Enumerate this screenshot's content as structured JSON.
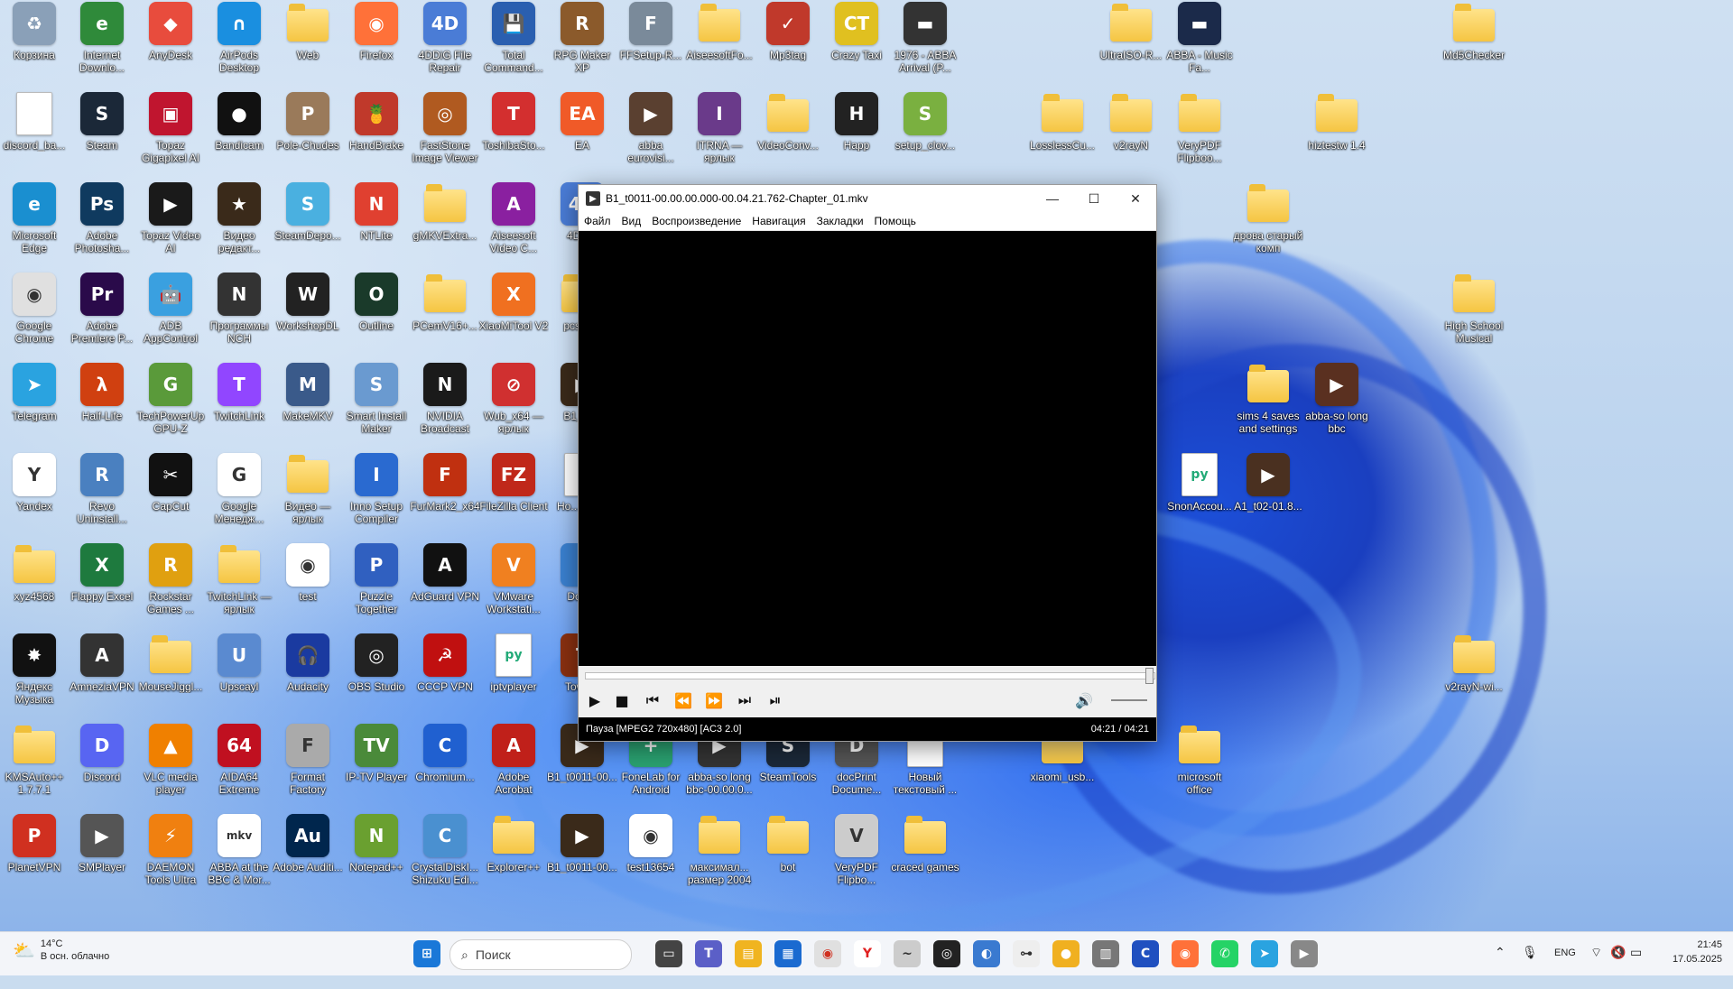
{
  "desktop": {
    "icons": [
      {
        "label": "Корзина",
        "color": "#8aa0b8",
        "glyph": "♻"
      },
      {
        "label": "Internet Downlo...",
        "color": "#2f8a3a",
        "glyph": "e"
      },
      {
        "label": "AnyDesk",
        "color": "#e84c3d",
        "glyph": "◆"
      },
      {
        "label": "AirPods Desktop",
        "color": "#1a8fe0",
        "glyph": "∩"
      },
      {
        "label": "Web",
        "color": "folder",
        "glyph": ""
      },
      {
        "label": "Firefox",
        "color": "#ff7139",
        "glyph": "◉"
      },
      {
        "label": "4DDiG File Repair",
        "color": "#4a7cd6",
        "glyph": "4D"
      },
      {
        "label": "Total Command...",
        "color": "#2a5fb0",
        "glyph": "💾"
      },
      {
        "label": "RPG Maker XP",
        "color": "#8b5a2b",
        "glyph": "R"
      },
      {
        "label": "FFSetup-R...",
        "color": "#7a8a9a",
        "glyph": "F"
      },
      {
        "label": "AiseesoftFo...",
        "color": "folder",
        "glyph": ""
      },
      {
        "label": "Mp3tag",
        "color": "#c0392b",
        "glyph": "✓"
      },
      {
        "label": "Crazy Taxi",
        "color": "#e0c020",
        "glyph": "CT"
      },
      {
        "label": "1976 - ABBA Arrival (P...",
        "color": "#333333",
        "glyph": "▬"
      },
      {
        "label": "UltraISO-R...",
        "color": "folder",
        "glyph": ""
      },
      {
        "label": "ABBA - Music Fa...",
        "color": "#1b2a4a",
        "glyph": "▬"
      },
      {
        "label": "Md5Checker",
        "color": "folder",
        "glyph": ""
      },
      {
        "label": "discord_ba...",
        "color": "doc",
        "glyph": ""
      },
      {
        "label": "Steam",
        "color": "#1b2838",
        "glyph": "S"
      },
      {
        "label": "Topaz Gigapixel AI",
        "color": "#c0152f",
        "glyph": "▣"
      },
      {
        "label": "Bandicam",
        "color": "#111111",
        "glyph": "●"
      },
      {
        "label": "Pole-Chudes",
        "color": "#9a7a5a",
        "glyph": "P"
      },
      {
        "label": "HandBrake",
        "color": "#c0392b",
        "glyph": "🍍"
      },
      {
        "label": "FastStone Image Viewer",
        "color": "#b05a20",
        "glyph": "◎"
      },
      {
        "label": "ToshibaSto...",
        "color": "#d32f2f",
        "glyph": "T"
      },
      {
        "label": "EA",
        "color": "#f05a28",
        "glyph": "EA"
      },
      {
        "label": "abba eurovisi...",
        "color": "#5a4030",
        "glyph": "▶"
      },
      {
        "label": "ITRNA — ярлык",
        "color": "#6a3a8a",
        "glyph": "I"
      },
      {
        "label": "VideoConv...",
        "color": "folder",
        "glyph": ""
      },
      {
        "label": "Happ",
        "color": "#222222",
        "glyph": "H"
      },
      {
        "label": "setup_clov...",
        "color": "#7ab040",
        "glyph": "S"
      },
      {
        "label": "LosslessCu...",
        "color": "folder",
        "glyph": ""
      },
      {
        "label": "v2rayN",
        "color": "folder",
        "glyph": ""
      },
      {
        "label": "VeryPDF Flipboo...",
        "color": "folder",
        "glyph": ""
      },
      {
        "label": "hiztestw 1.4",
        "color": "folder",
        "glyph": ""
      },
      {
        "label": "Microsoft Edge",
        "color": "#1a8fd0",
        "glyph": "e"
      },
      {
        "label": "Adobe Photosha...",
        "color": "#0f3a5f",
        "glyph": "Ps"
      },
      {
        "label": "Topaz Video AI",
        "color": "#1a1a1a",
        "glyph": "▶"
      },
      {
        "label": "Видео редакт...",
        "color": "#3a2a1a",
        "glyph": "★"
      },
      {
        "label": "SteamDepo...",
        "color": "#4ab0e0",
        "glyph": "S"
      },
      {
        "label": "NTLite",
        "color": "#e04030",
        "glyph": "N"
      },
      {
        "label": "gMKVExtra...",
        "color": "folder",
        "glyph": ""
      },
      {
        "label": "Aiseesoft Video C...",
        "color": "#8a20a0",
        "glyph": "A"
      },
      {
        "label": "4DD...",
        "color": "#4a7cd6",
        "glyph": "4D"
      },
      {
        "label": "дрова старый комп",
        "color": "folder",
        "glyph": ""
      },
      {
        "label": "Google Chrome",
        "color": "#e0e0e0",
        "glyph": "◉"
      },
      {
        "label": "Adobe Premiere P...",
        "color": "#2a0a4a",
        "glyph": "Pr"
      },
      {
        "label": "ADB AppControl",
        "color": "#3aa0e0",
        "glyph": "🤖"
      },
      {
        "label": "Программы NCH",
        "color": "#333333",
        "glyph": "N"
      },
      {
        "label": "WorkshopDL",
        "color": "#222222",
        "glyph": "W"
      },
      {
        "label": "Outline",
        "color": "#1a3a2a",
        "glyph": "O"
      },
      {
        "label": "PCemV16+...",
        "color": "folder",
        "glyph": ""
      },
      {
        "label": "XiaoMiTool V2",
        "color": "#f07020",
        "glyph": "X"
      },
      {
        "label": "pcsx2...",
        "color": "folder",
        "glyph": ""
      },
      {
        "label": "High School Musical",
        "color": "folder",
        "glyph": ""
      },
      {
        "label": "Telegram",
        "color": "#2aa3e0",
        "glyph": "➤"
      },
      {
        "label": "Half-Life",
        "color": "#d04010",
        "glyph": "λ"
      },
      {
        "label": "TechPowerUp GPU-Z",
        "color": "#5a9a3a",
        "glyph": "G"
      },
      {
        "label": "TwitchLink",
        "color": "#9146ff",
        "glyph": "T"
      },
      {
        "label": "MakeMKV",
        "color": "#3a5a8a",
        "glyph": "M"
      },
      {
        "label": "Smart Install Maker",
        "color": "#6a9ad0",
        "glyph": "S"
      },
      {
        "label": "NVIDIA Broadcast",
        "color": "#1a1a1a",
        "glyph": "N"
      },
      {
        "label": "Wub_x64 — ярлык",
        "color": "#d03030",
        "glyph": "⊘"
      },
      {
        "label": "B1_t0...",
        "color": "#3a2a1a",
        "glyph": "▶"
      },
      {
        "label": "sims 4 saves and settings",
        "color": "folder",
        "glyph": ""
      },
      {
        "label": "abba-so long bbc",
        "color": "#5a3020",
        "glyph": "▶"
      },
      {
        "label": "Yandex",
        "color": "#ffffff",
        "glyph": "Y"
      },
      {
        "label": "Revo Uninstall...",
        "color": "#4a80c0",
        "glyph": "R"
      },
      {
        "label": "CapCut",
        "color": "#111111",
        "glyph": "✂"
      },
      {
        "label": "Google Менедж...",
        "color": "#ffffff",
        "glyph": "G"
      },
      {
        "label": "Видео — ярлык",
        "color": "folder",
        "glyph": ""
      },
      {
        "label": "Inno Setup Compiler",
        "color": "#2a6ad0",
        "glyph": "I"
      },
      {
        "label": "FurMark2_x64",
        "color": "#c03010",
        "glyph": "F"
      },
      {
        "label": "FileZilla Client",
        "color": "#c0281a",
        "glyph": "FZ"
      },
      {
        "label": "Ho... тек...",
        "color": "doc",
        "glyph": ""
      },
      {
        "label": "SnonAccou...",
        "color": "doc",
        "glyph": "py"
      },
      {
        "label": "A1_t02-01.8...",
        "color": "#4a3020",
        "glyph": "▶"
      },
      {
        "label": "xyz4568",
        "color": "folder",
        "glyph": ""
      },
      {
        "label": "Flappy Excel",
        "color": "#1e7a3e",
        "glyph": "X"
      },
      {
        "label": "Rockstar Games ...",
        "color": "#e0a010",
        "glyph": "R"
      },
      {
        "label": "TwitchLink — ярлык",
        "color": "folder",
        "glyph": ""
      },
      {
        "label": "test",
        "color": "#ffffff",
        "glyph": "◉"
      },
      {
        "label": "Puzzle Together",
        "color": "#3060c0",
        "glyph": "P"
      },
      {
        "label": "AdGuard VPN",
        "color": "#111111",
        "glyph": "A"
      },
      {
        "label": "VMware Workstati...",
        "color": "#f08020",
        "glyph": "V"
      },
      {
        "label": "Dow...",
        "color": "#3a80d0",
        "glyph": "↓"
      },
      {
        "label": "Яндекс Музыка",
        "color": "#111111",
        "glyph": "✸"
      },
      {
        "label": "AmneziaVPN",
        "color": "#333333",
        "glyph": "A"
      },
      {
        "label": "MouseJiggl...",
        "color": "folder",
        "glyph": ""
      },
      {
        "label": "Upscayl",
        "color": "#5a8ad0",
        "glyph": "U"
      },
      {
        "label": "Audacity",
        "color": "#1a3aa0",
        "glyph": "🎧"
      },
      {
        "label": "OBS Studio",
        "color": "#222222",
        "glyph": "◎"
      },
      {
        "label": "CCCP VPN",
        "color": "#c01010",
        "glyph": "☭"
      },
      {
        "label": "iptvplayer",
        "color": "doc",
        "glyph": "py"
      },
      {
        "label": "Town...",
        "color": "#8a3010",
        "glyph": "T"
      },
      {
        "label": "v2rayN-wi...",
        "color": "folder",
        "glyph": ""
      },
      {
        "label": "KMSAuto++ 1.7.7.1",
        "color": "folder",
        "glyph": ""
      },
      {
        "label": "Discord",
        "color": "#5865f2",
        "glyph": "D"
      },
      {
        "label": "VLC media player",
        "color": "#f08000",
        "glyph": "▲"
      },
      {
        "label": "AIDA64 Extreme",
        "color": "#c01020",
        "glyph": "64"
      },
      {
        "label": "Format Factory",
        "color": "#aaaaaa",
        "glyph": "F"
      },
      {
        "label": "IP-TV Player",
        "color": "#4a8a3a",
        "glyph": "TV"
      },
      {
        "label": "Chromium...",
        "color": "#2060d0",
        "glyph": "C"
      },
      {
        "label": "Adobe Acrobat",
        "color": "#c0201a",
        "glyph": "A"
      },
      {
        "label": "B1_t0011-00...",
        "color": "#3a2a1a",
        "glyph": "▶"
      },
      {
        "label": "FoneLab for Android",
        "color": "#2aa070",
        "glyph": "+"
      },
      {
        "label": "abba-so long bbc-00.00.0...",
        "color": "#333333",
        "glyph": "▶"
      },
      {
        "label": "SteamTools",
        "color": "#1b2838",
        "glyph": "S"
      },
      {
        "label": "docPrint Docume...",
        "color": "#555555",
        "glyph": "D"
      },
      {
        "label": "Новый текстовый ...",
        "color": "doc",
        "glyph": ""
      },
      {
        "label": "xiaomi_usb...",
        "color": "folder",
        "glyph": ""
      },
      {
        "label": "microsoft office",
        "color": "folder",
        "glyph": ""
      },
      {
        "label": "PlanetVPN",
        "color": "#d03020",
        "glyph": "P"
      },
      {
        "label": "SMPlayer",
        "color": "#555555",
        "glyph": "▶"
      },
      {
        "label": "DAEMON Tools Ultra",
        "color": "#f08010",
        "glyph": "⚡"
      },
      {
        "label": "ABBA at the BBC & Mor...",
        "color": "#ffffff",
        "glyph": "mkv"
      },
      {
        "label": "Adobe Auditi...",
        "color": "#00264d",
        "glyph": "Au"
      },
      {
        "label": "Notepad++",
        "color": "#6aa030",
        "glyph": "N"
      },
      {
        "label": "CrystalDiskI... Shizuku Edi...",
        "color": "#4a90d0",
        "glyph": "C"
      },
      {
        "label": "Explorer++",
        "color": "folder",
        "glyph": ""
      },
      {
        "label": "B1_t0011-00...",
        "color": "#3a2a1a",
        "glyph": "▶"
      },
      {
        "label": "test13654",
        "color": "#ffffff",
        "glyph": "◉"
      },
      {
        "label": "максимал... размер 2004",
        "color": "folder",
        "glyph": ""
      },
      {
        "label": "bot",
        "color": "folder",
        "glyph": ""
      },
      {
        "label": "VeryPDF Flipbo...",
        "color": "#cccccc",
        "glyph": "V"
      },
      {
        "label": "craced games",
        "color": "folder",
        "glyph": ""
      }
    ]
  },
  "player": {
    "title": "B1_t0011-00.00.00.000-00.04.21.762-Chapter_01.mkv",
    "menu": [
      "Файл",
      "Вид",
      "Воспроизведение",
      "Навигация",
      "Закладки",
      "Помощь"
    ],
    "status_left": "Пауза   [MPEG2 720x480]   [AC3 2.0]",
    "status_right": "04:21 / 04:21",
    "progress": 1.0
  },
  "taskbar": {
    "weather_temp": "14°C",
    "weather_desc": "В осн. облачно",
    "search_placeholder": "Поиск",
    "lang": "ENG",
    "time": "21:45",
    "date": "17.05.2025"
  }
}
